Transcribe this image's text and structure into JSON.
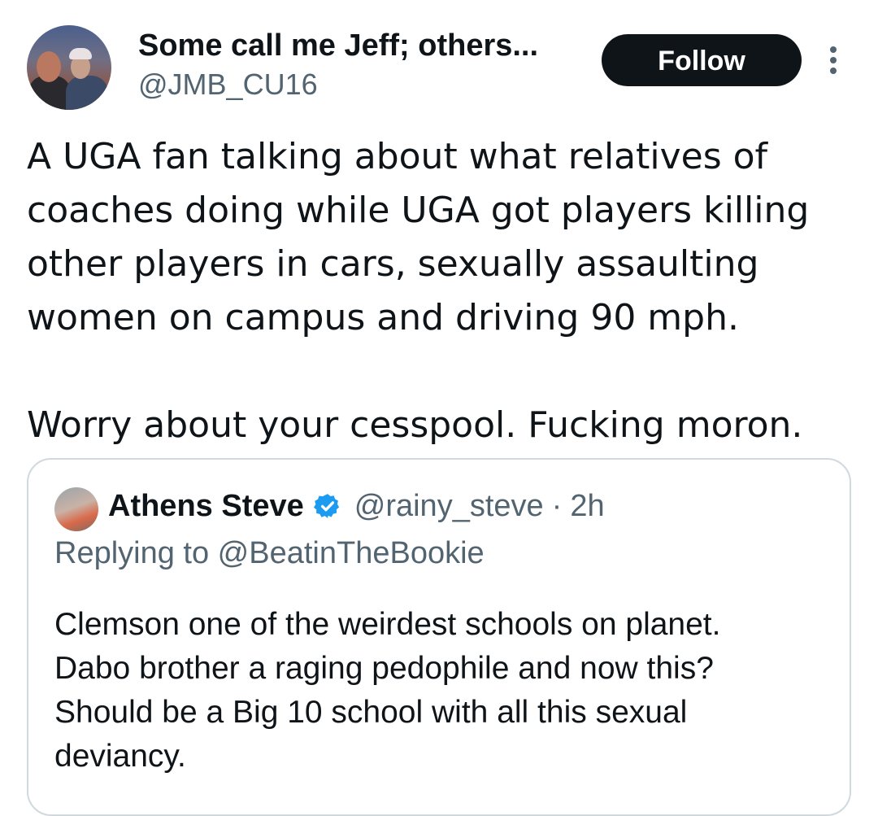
{
  "author": {
    "display_name": "Some call me Jeff; others...",
    "handle": "@JMB_CU16"
  },
  "follow_label": "Follow",
  "tweet_lines": [
    "A UGA fan talking about what relatives of",
    "coaches doing while UGA got players killing",
    "other players in cars, sexually assaulting",
    "women on campus and driving 90 mph.",
    "Worry about your cesspool. Fucking moron."
  ],
  "quote": {
    "display_name": "Athens Steve",
    "handle": "@rainy_steve",
    "separator": "·",
    "time": "2h",
    "replying_to": "Replying to @BeatinTheBookie",
    "text_lines": [
      "Clemson one of the weirdest schools on planet.",
      "Dabo brother a raging pedophile and now this?",
      "Should be a Big 10 school with all this sexual",
      "deviancy."
    ]
  },
  "colors": {
    "primary_text": "#0f1419",
    "secondary_text": "#536471",
    "follow_button_bg": "#0f1419",
    "verified_badge": "#1d9bf0",
    "card_border": "#cfd9de"
  },
  "icons": {
    "more": "more-vertical-icon",
    "verified": "verified-badge-icon"
  }
}
